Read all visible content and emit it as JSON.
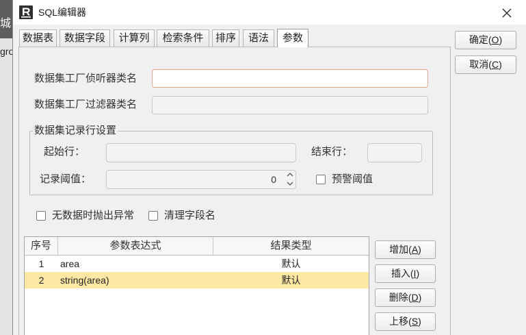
{
  "background_window": {
    "top_fragment": "城",
    "text_fragment": "gro"
  },
  "window": {
    "title": "SQL编辑器",
    "icon": "app-logo-icon",
    "close_icon": "close-icon"
  },
  "tabs": [
    {
      "label": "数据表",
      "selected": false
    },
    {
      "label": "数据字段",
      "selected": false
    },
    {
      "label": "计算列",
      "selected": false
    },
    {
      "label": "检索条件",
      "selected": false
    },
    {
      "label": "排序",
      "selected": false
    },
    {
      "label": "语法",
      "selected": false
    },
    {
      "label": "参数",
      "selected": true
    }
  ],
  "dialog_buttons": {
    "ok": "确定(O)",
    "cancel": "取消(C)"
  },
  "params": {
    "listener_class": {
      "label": "数据集工厂侦听器类名",
      "focused": true
    },
    "filter_class": {
      "label": "数据集工厂过滤器类名"
    },
    "row_settings": {
      "title": "数据集记录行设置",
      "start_row_label": "起始行：",
      "end_row_label": "结束行：",
      "record_threshold": {
        "label": "记录阈值：",
        "value": "0"
      },
      "warning_threshold": {
        "label": "预警阈值",
        "checked": false
      }
    },
    "throw_on_no_data": {
      "label": "无数据时抛出异常",
      "checked": false
    },
    "clean_field_names": {
      "label": "清理字段名",
      "checked": false
    }
  },
  "param_table": {
    "columns": [
      "序号",
      "参数表达式",
      "结果类型"
    ],
    "rows": [
      {
        "index": "1",
        "expression": "area",
        "result_type": "默认",
        "selected": false
      },
      {
        "index": "2",
        "expression": "string(area)",
        "result_type": "默认",
        "selected": true
      }
    ]
  },
  "table_buttons": {
    "add": "增加(A)",
    "insert": "插入(I)",
    "delete": "删除(D)",
    "move_up": "上移(S)"
  },
  "colors": {
    "selected_row": "#ffe8a4",
    "focus_border": "#e2a982"
  }
}
